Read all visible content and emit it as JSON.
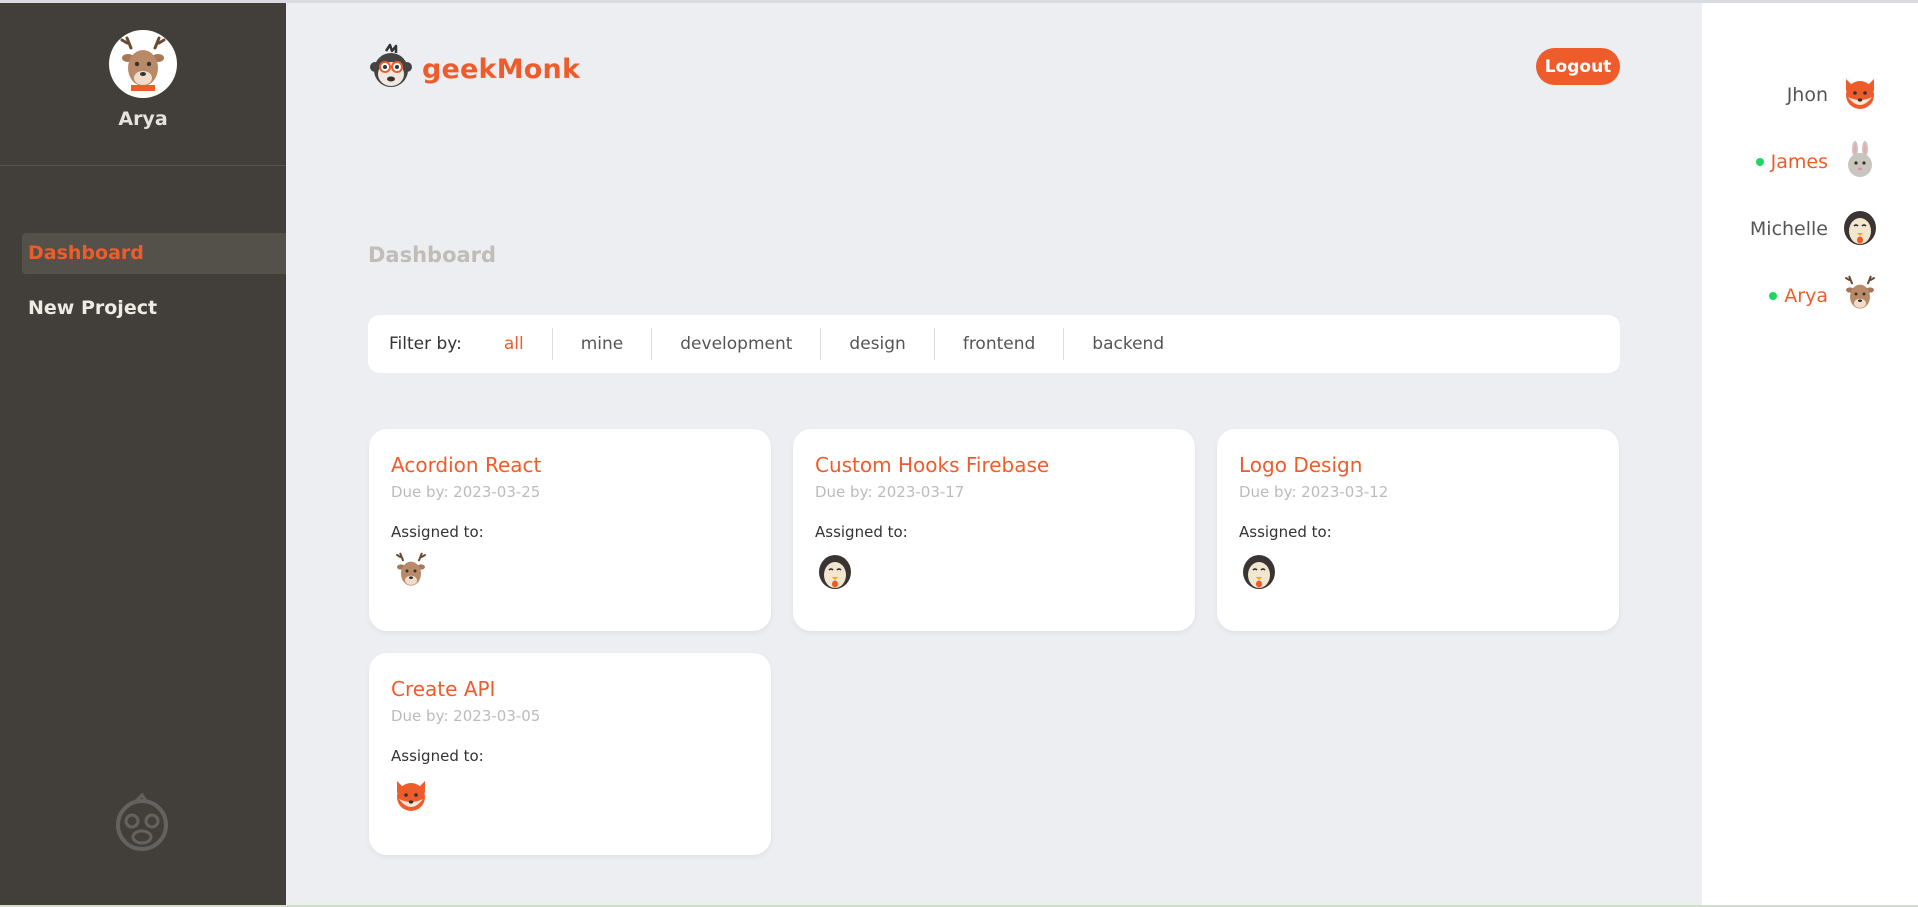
{
  "colors": {
    "accent": "#ef5c2c",
    "sidebar": "#423f3b",
    "online": "#1ed760"
  },
  "sidebar": {
    "username": "Arya",
    "avatar_icon": "deer-avatar",
    "nav": [
      {
        "label": "Dashboard",
        "icon": "dashboard-icon",
        "active": true
      },
      {
        "label": "New Project",
        "icon": "add-icon",
        "active": false
      }
    ]
  },
  "header": {
    "brand": "geekMonk",
    "logout_label": "Logout"
  },
  "page": {
    "title": "Dashboard"
  },
  "filter": {
    "label": "Filter by:",
    "options": [
      "all",
      "mine",
      "development",
      "design",
      "frontend",
      "backend"
    ],
    "active": "all"
  },
  "projects": [
    {
      "title": "Acordion React",
      "due": "Due by: 2023-03-25",
      "assigned_label": "Assigned to:",
      "assignee_avatar": "deer-avatar"
    },
    {
      "title": "Custom Hooks Firebase",
      "due": "Due by: 2023-03-17",
      "assigned_label": "Assigned to:",
      "assignee_avatar": "penguin-avatar"
    },
    {
      "title": "Logo Design",
      "due": "Due by: 2023-03-12",
      "assigned_label": "Assigned to:",
      "assignee_avatar": "penguin-avatar"
    },
    {
      "title": "Create API",
      "due": "Due by: 2023-03-05",
      "assigned_label": "Assigned to:",
      "assignee_avatar": "fox-avatar"
    }
  ],
  "users": [
    {
      "name": "Jhon",
      "online": false,
      "avatar": "fox-avatar"
    },
    {
      "name": "James",
      "online": true,
      "avatar": "rabbit-avatar"
    },
    {
      "name": "Michelle",
      "online": false,
      "avatar": "penguin-avatar"
    },
    {
      "name": "Arya",
      "online": true,
      "avatar": "deer-avatar"
    }
  ]
}
